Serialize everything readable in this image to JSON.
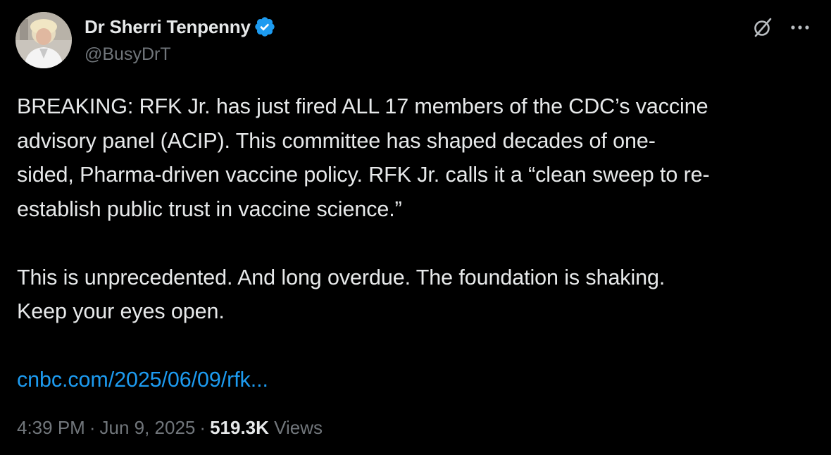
{
  "author": {
    "display_name": "Dr Sherri Tenpenny",
    "handle": "@BusyDrT",
    "verified": true
  },
  "icons": {
    "verified": "verified-badge-icon",
    "grok": "grok-icon",
    "more": "more-dots-icon"
  },
  "colors": {
    "background": "#000000",
    "text": "#e7e9ea",
    "muted": "#71767b",
    "link": "#1d9bf0",
    "verified": "#1d9bf0"
  },
  "tweet": {
    "lines_p1": [
      "BREAKING: RFK Jr. has just fired ALL 17 members of the CDC’s vaccine",
      "advisory panel (ACIP). This committee has shaped decades of one-",
      "sided, Pharma-driven vaccine policy. RFK Jr. calls it a “clean sweep to re-",
      "establish public trust in vaccine science.”"
    ],
    "lines_p2": [
      "This is unprecedented. And long overdue. The foundation is shaking.",
      "Keep your eyes open."
    ],
    "link": "cnbc.com/2025/06/09/rfk..."
  },
  "meta": {
    "time": "4:39 PM",
    "separator": "·",
    "date": "Jun 9, 2025",
    "views_count": "519.3K",
    "views_label": "Views"
  }
}
